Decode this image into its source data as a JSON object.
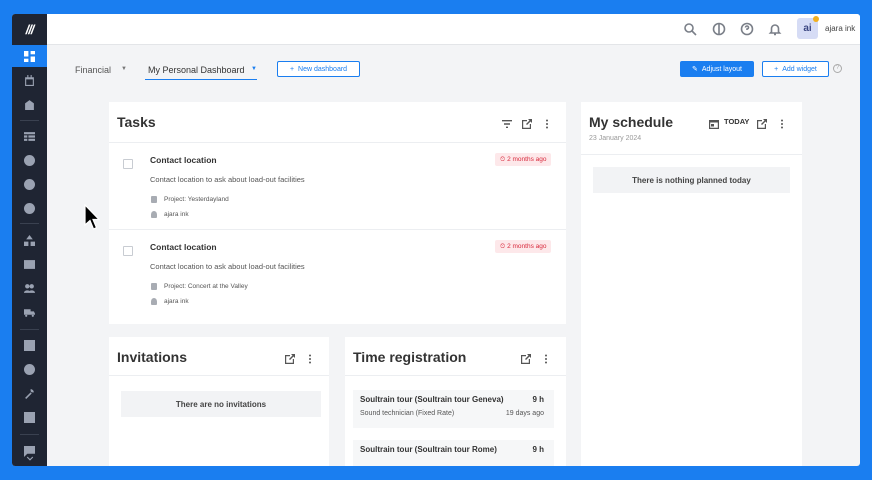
{
  "colors": {
    "accent": "#1a7ef0",
    "sidebar": "#1f2533",
    "danger": "#d8283b"
  },
  "sidebar": {
    "logo": "///",
    "items": [
      {
        "icon": "dashboard-icon",
        "active": true
      },
      {
        "icon": "calendar-icon"
      },
      {
        "icon": "building-icon"
      },
      {
        "icon": "table-icon"
      },
      {
        "icon": "user-icon"
      },
      {
        "icon": "compass-icon"
      },
      {
        "icon": "dollar-icon"
      },
      {
        "icon": "shapes-icon"
      },
      {
        "icon": "id-card-icon"
      },
      {
        "icon": "people-icon"
      },
      {
        "icon": "truck-icon"
      },
      {
        "icon": "checkbox-icon"
      },
      {
        "icon": "clock-icon"
      },
      {
        "icon": "wrench-icon"
      },
      {
        "icon": "image-icon"
      },
      {
        "icon": "feedback-icon"
      },
      {
        "icon": "chevron-down-icon"
      }
    ]
  },
  "topbar": {
    "icons": [
      "search-icon",
      "contrast-icon",
      "help-icon",
      "bell-icon"
    ],
    "avatar_initials": "ai",
    "user_name": "ajara ink"
  },
  "toolbar": {
    "dashboard_category": "Financial",
    "dashboard_name": "My Personal Dashboard",
    "new_dashboard": "New dashboard",
    "adjust_layout": "Adjust layout",
    "add_widget": "Add widget",
    "plus": "+"
  },
  "tasks": {
    "title": "Tasks",
    "items": [
      {
        "title": "Contact location",
        "description": "Contact location to ask about load-out facilities",
        "project": "Project: Yesterdayland",
        "assignee": "ajara ink",
        "due": "2 months ago"
      },
      {
        "title": "Contact location",
        "description": "Contact location to ask about load-out facilities",
        "project": "Project: Concert at the Valley",
        "assignee": "ajara ink",
        "due": "2 months ago"
      }
    ]
  },
  "schedule": {
    "title": "My schedule",
    "today_label": "TODAY",
    "date": "23 January 2024",
    "empty": "There is nothing planned today"
  },
  "invitations": {
    "title": "Invitations",
    "empty": "There are no invitations"
  },
  "time_registration": {
    "title": "Time registration",
    "rows": [
      {
        "title": "Soultrain tour (Soultrain tour Geneva)",
        "hours": "9 h",
        "sub": "Sound technician (Fixed Rate)",
        "ago": "19 days ago"
      },
      {
        "title": "Soultrain tour (Soultrain tour Rome)",
        "hours": "9 h",
        "sub": "",
        "ago": ""
      }
    ]
  }
}
